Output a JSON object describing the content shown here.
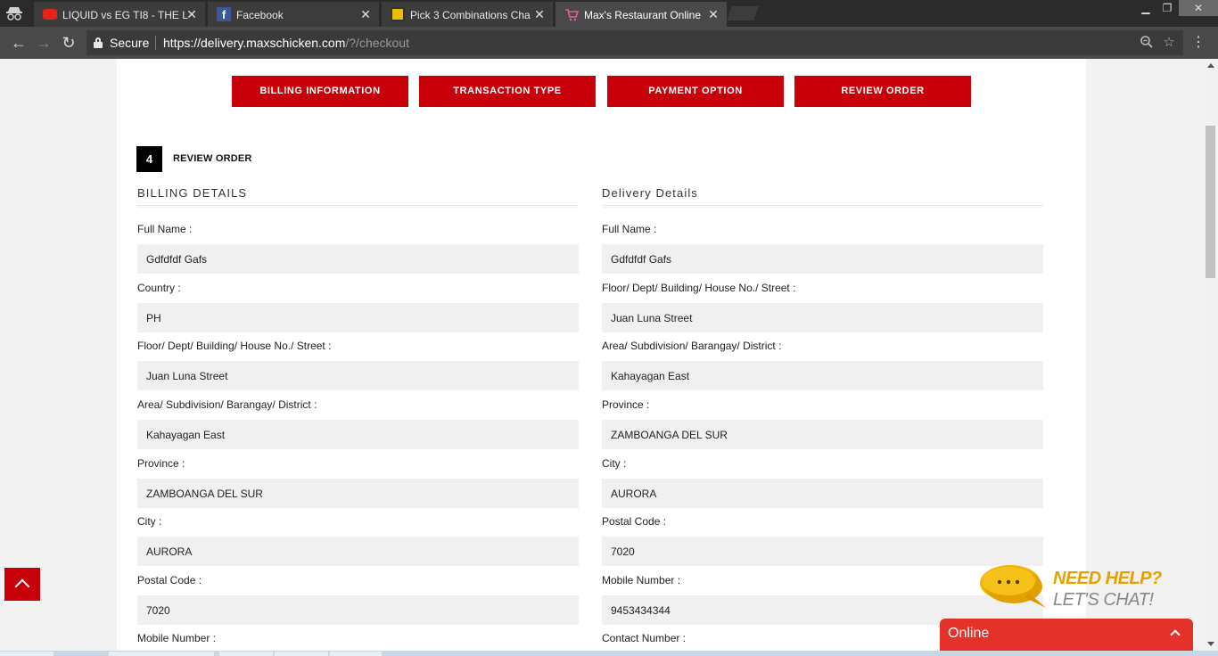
{
  "browser": {
    "tabs": [
      {
        "title": "LIQUID vs EG TI8 - THE L",
        "favicon": "youtube-icon",
        "color": "#e62117"
      },
      {
        "title": "Facebook",
        "favicon": "facebook-icon",
        "color": "#3b5998"
      },
      {
        "title": "Pick 3 Combinations Cha",
        "favicon": "lotto-icon",
        "color": "#e8c000"
      },
      {
        "title": "Max's Restaurant Online",
        "favicon": "cart-icon",
        "color": "#e060a0"
      }
    ],
    "secure_label": "Secure",
    "url_host": "https://delivery.maxschicken.com",
    "url_path": "/?/checkout"
  },
  "steps": {
    "billing": "BILLING INFORMATION",
    "transaction": "TRANSACTION TYPE",
    "payment": "PAYMENT OPTION",
    "review": "REVIEW ORDER"
  },
  "review": {
    "number": "4",
    "title": "REVIEW ORDER"
  },
  "billing": {
    "heading": "BILLING DETAILS",
    "fields": [
      {
        "label": "Full Name :",
        "value": "Gdfdfdf Gafs"
      },
      {
        "label": "Country :",
        "value": "PH"
      },
      {
        "label": "Floor/ Dept/ Building/ House No./ Street :",
        "value": "Juan Luna Street"
      },
      {
        "label": "Area/ Subdivision/ Barangay/ District :",
        "value": "Kahayagan East"
      },
      {
        "label": "Province :",
        "value": "ZAMBOANGA DEL SUR"
      },
      {
        "label": "City :",
        "value": "AURORA"
      },
      {
        "label": "Postal Code :",
        "value": "7020"
      },
      {
        "label": "Mobile Number :",
        "value": ""
      }
    ]
  },
  "delivery": {
    "heading": "Delivery Details",
    "fields": [
      {
        "label": "Full Name :",
        "value": "Gdfdfdf Gafs"
      },
      {
        "label": "Floor/ Dept/ Building/ House No./ Street :",
        "value": "Juan Luna Street"
      },
      {
        "label": "Area/ Subdivision/ Barangay/ District :",
        "value": "Kahayagan East"
      },
      {
        "label": "Province :",
        "value": "ZAMBOANGA DEL SUR"
      },
      {
        "label": "City :",
        "value": "AURORA"
      },
      {
        "label": "Postal Code :",
        "value": "7020"
      },
      {
        "label": "Mobile Number :",
        "value": "9453434344"
      },
      {
        "label": "Contact Number :",
        "value": ""
      }
    ]
  },
  "help": {
    "line1": "NEED HELP?",
    "line2": "LET'S CHAT!"
  },
  "chat": {
    "status": "Online"
  },
  "colors": {
    "brand_red": "#c8000a",
    "chat_red": "#e4322b",
    "help_yellow": "#e8a000"
  }
}
